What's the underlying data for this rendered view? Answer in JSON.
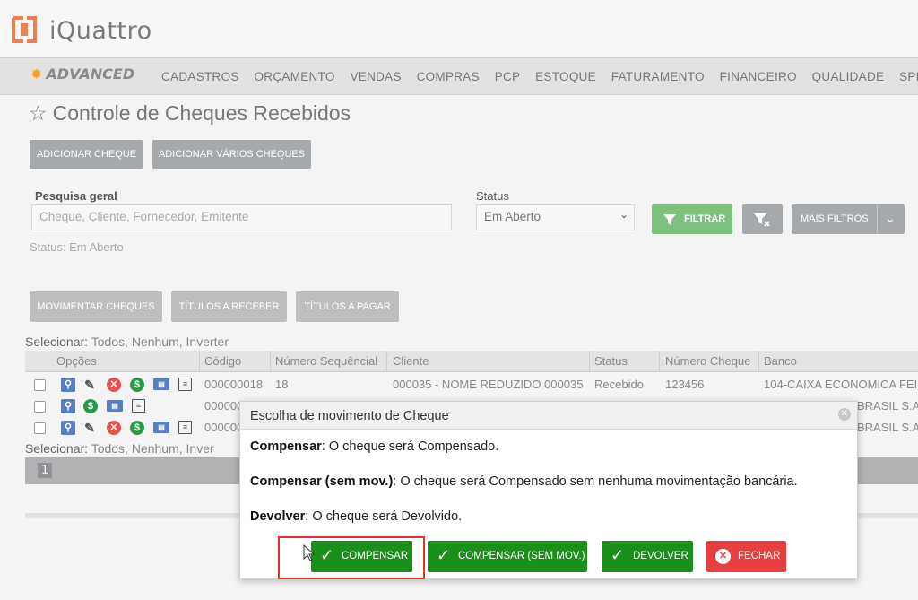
{
  "brand": {
    "name": "iQuattro",
    "edition": "ADVANCED",
    "accent": "#f0a030"
  },
  "menu": [
    "CADASTROS",
    "ORÇAMENTO",
    "VENDAS",
    "COMPRAS",
    "PCP",
    "ESTOQUE",
    "FATURAMENTO",
    "FINANCEIRO",
    "QUALIDADE",
    "SPE"
  ],
  "page": {
    "title": "Controle de Cheques Recebidos"
  },
  "toolbar": {
    "add": "ADICIONAR CHEQUE",
    "add_many": "ADICIONAR VÁRIOS CHEQUES"
  },
  "filters": {
    "search_label": "Pesquisa geral",
    "search_placeholder": "Cheque, Cliente, Fornecedor, Emitente",
    "status_label": "Status",
    "status_value": "Em Aberto",
    "filter_button": "FILTRAR",
    "more_filters": "MAIS FILTROS",
    "status_summary": "Status: Em Aberto"
  },
  "actions": {
    "move": "MOVIMENTAR CHEQUES",
    "receivable": "TÍTULOS A RECEBER",
    "payable": "TÍTULOS A PAGAR"
  },
  "selection": {
    "label": "Selecionar:",
    "options": "Todos, Nenhum, Inverter",
    "options_truncated": "Todos, Nenhum, Inver"
  },
  "grid": {
    "columns": [
      "Opções",
      "Código",
      "Número Sequêncial",
      "Cliente",
      "Status",
      "Número Cheque",
      "Banco"
    ],
    "rows": [
      {
        "codigo": "000000018",
        "seq": "18",
        "cliente": "000035 - NOME REDUZIDO 000035",
        "status": "Recebido",
        "numero": "123456",
        "banco": "104-CAIXA ECONOMICA FEI"
      },
      {
        "codigo": "000000",
        "banco": "BRASIL S.A."
      },
      {
        "codigo": "000000",
        "banco": "BRASIL S.A."
      }
    ],
    "page": "1"
  },
  "dialog": {
    "title": "Escolha de movimento de Cheque",
    "lines": [
      {
        "term": "Compensar",
        "text": ": O cheque será Compensado."
      },
      {
        "term": "Compensar (sem mov.)",
        "text": ": O cheque será Compensado sem nenhuma movimentação bancária."
      },
      {
        "term": "Devolver",
        "text": ": O cheque será Devolvido."
      }
    ],
    "buttons": {
      "compensar": "COMPENSAR",
      "compensar_sem": "COMPENSAR (SEM MOV.)",
      "devolver": "DEVOLVER",
      "fechar": "FECHAR"
    }
  },
  "colors": {
    "green": "#1a8f1a",
    "red": "#e84040",
    "highlight": "#e53030"
  }
}
